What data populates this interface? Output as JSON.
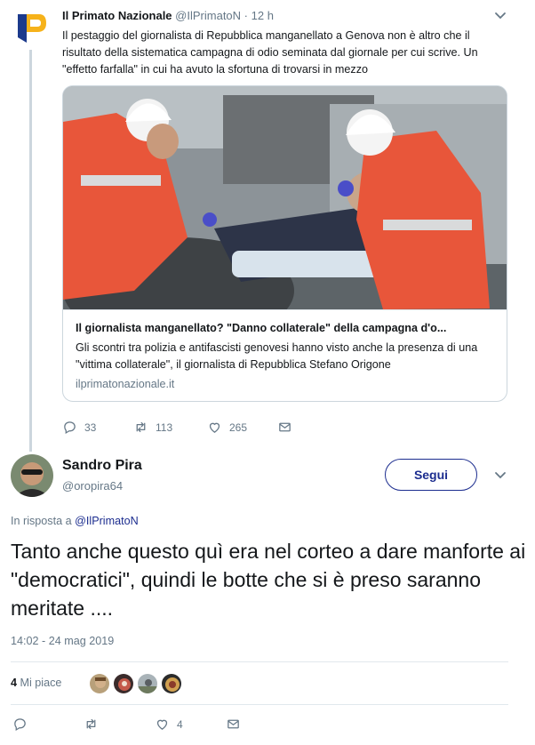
{
  "quoted_tweet": {
    "author_name": "Il Primato Nazionale",
    "author_handle": "@IlPrimatoN",
    "separator": "·",
    "time": "12 h",
    "text": "Il pestaggio del giornalista di Repubblica manganellato a Genova non è altro che il risultato della sistematica campagna di odio seminata dal giornale per cui scrive. Un \"effetto farfalla\" in cui ha avuto la sfortuna di trovarsi in mezzo",
    "card": {
      "title": "Il giornalista manganellato? \"Danno collaterale\" della campagna d'o...",
      "description": "Gli scontri tra polizia e antifascisti genovesi hanno visto anche la presenza di una \"vittima collaterale\", il giornalista di Repubblica Stefano Origone",
      "domain": "ilprimatonazionale.it"
    },
    "actions": {
      "replies": "33",
      "retweets": "113",
      "likes": "265"
    }
  },
  "reply_tweet": {
    "author_name": "Sandro Pira",
    "author_handle": "@oropira64",
    "follow_label": "Segui",
    "reply_prefix": "In risposta a",
    "reply_mention": "@IlPrimatoN",
    "text": "Tanto anche questo quì era nel corteo a dare manforte ai \"democratici\", quindi le botte che si è preso saranno meritate ....",
    "timestamp": "14:02 - 24 mag 2019",
    "likes_count": "4",
    "likes_label": "Mi piace",
    "actions": {
      "likes": "4"
    }
  },
  "colors": {
    "accent": "#1c2d8f",
    "muted": "#657786",
    "text": "#14171a",
    "border": "#e1e8ed"
  },
  "icons": [
    "reply-icon",
    "retweet-icon",
    "heart-icon",
    "mail-icon",
    "chevron-down-icon"
  ]
}
